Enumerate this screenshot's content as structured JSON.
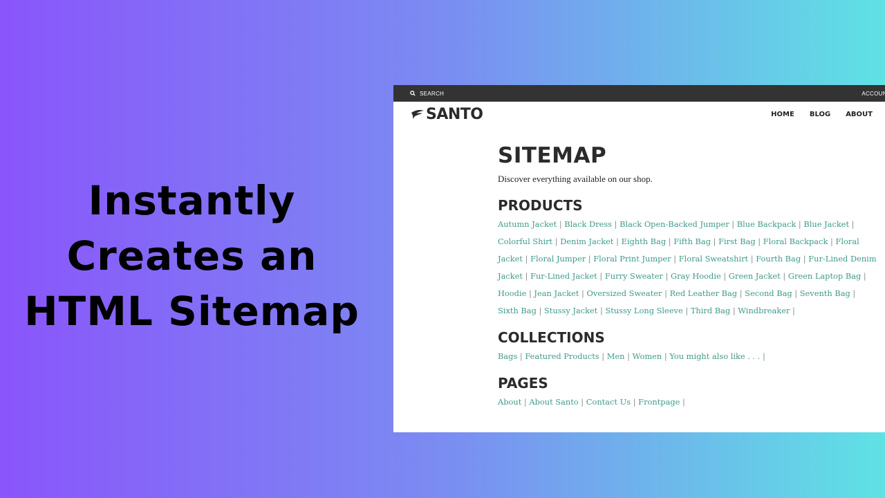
{
  "headline": [
    "Instantly",
    "Creates an",
    "HTML Sitemap"
  ],
  "topbar": {
    "search_label": "SEARCH",
    "account_label": "ACCOUNT"
  },
  "nav": {
    "logo": "SANTO",
    "items": [
      "HOME",
      "BLOG",
      "ABOUT"
    ]
  },
  "page": {
    "title": "SITEMAP",
    "intro": "Discover everything available on our shop."
  },
  "sections": [
    {
      "title": "PRODUCTS",
      "links": [
        "Autumn Jacket",
        "Black Dress",
        "Black Open-Backed Jumper",
        "Blue Backpack",
        "Blue Jacket",
        "Colorful Shirt",
        "Denim Jacket",
        "Eighth Bag",
        "Fifth Bag",
        "First Bag",
        "Floral Backpack",
        "Floral Jacket",
        "Floral Jumper",
        "Floral Print Jumper",
        "Floral Sweatshirt",
        "Fourth Bag",
        "Fur-Lined Denim Jacket",
        "Fur-Lined Jacket",
        "Furry Sweater",
        "Gray Hoodie",
        "Green Jacket",
        "Green Laptop Bag",
        "Hoodie",
        "Jean Jacket",
        "Oversized Sweater",
        "Red Leather Bag",
        "Second Bag",
        "Seventh Bag",
        "Sixth Bag",
        "Stussy Jacket",
        "Stussy Long Sleeve",
        "Third Bag",
        "Windbreaker"
      ]
    },
    {
      "title": "COLLECTIONS",
      "links": [
        "Bags",
        "Featured Products",
        "Men",
        "Women",
        "You might also like . . ."
      ]
    },
    {
      "title": "PAGES",
      "links": [
        "About",
        "About Santo",
        "Contact Us",
        "Frontpage"
      ]
    }
  ],
  "colors": {
    "link": "#3f9a8a",
    "topbar": "#333333",
    "gradient_start": "#8a55fb",
    "gradient_end": "#5fe2e4"
  }
}
